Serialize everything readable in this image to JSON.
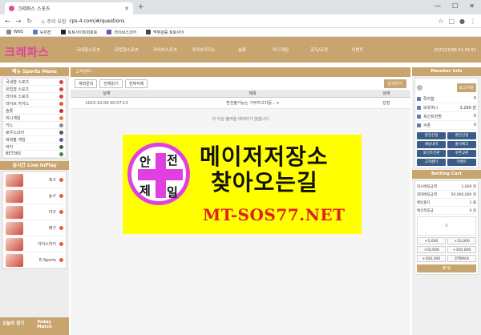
{
  "browser": {
    "tab_title": "크레파스 스포츠",
    "address_warning": "주의 요함",
    "url": "cps-4.com/#/questions",
    "bookmarks": [
      "WNS",
      "뉴미젼",
      "토토사이트회토토",
      "라이브스코어",
      "먹튀검증 토토사이"
    ]
  },
  "header": {
    "logo": "크레파스",
    "nav": [
      "국내형스포츠",
      "유럽형스포츠",
      "라이브스포츠",
      "라이브카지노",
      "슬롯",
      "미니게임",
      "공지/규정",
      "이벤트"
    ],
    "datetime": "2022/10/06 01:05:51"
  },
  "left": {
    "menu_title": "메뉴 Sports Menu",
    "sports": [
      {
        "label": "국내형 스포츠",
        "color": "#d24141"
      },
      {
        "label": "유럽형 스포츠",
        "color": "#d24141"
      },
      {
        "label": "라이브 스포츠",
        "color": "#d24141"
      },
      {
        "label": "라이브 카지노",
        "color": "#e06020"
      },
      {
        "label": "슬롯",
        "color": "#c03030"
      },
      {
        "label": "미니게임",
        "color": "#e08030"
      },
      {
        "label": "키노",
        "color": "#888888"
      },
      {
        "label": "로우스코어",
        "color": "#555555"
      },
      {
        "label": "파워볼 게임",
        "color": "#5a5ab0"
      },
      {
        "label": "바카",
        "color": "#555555"
      },
      {
        "label": "BET365",
        "color": "#3a8a3a"
      }
    ],
    "inplay_title": "실시간 Live InPlay",
    "inplay": [
      "축구",
      "농구",
      "야구",
      "배구",
      "아이스하키",
      "E-Sports"
    ],
    "today_title_1": "오늘의 경기",
    "today_title_2": "Today Match"
  },
  "main": {
    "title": "고객센터",
    "tabs": [
      "계좌문의",
      "전체읽기",
      "전체삭제"
    ],
    "inquiry_button": "문의하기",
    "columns": [
      "날짜",
      "제목",
      "상태"
    ],
    "rows": [
      {
        "date": "2022-10-06 00:57:13",
        "title": "환전불가능는 거부하고자동...",
        "status": "답장"
      }
    ],
    "notice": "더 이상 불러올 데이터가 없습니다"
  },
  "right": {
    "member_title": "Member Info",
    "logout": "로그아웃",
    "info_rows": [
      {
        "label": "쪽지함",
        "value": "0"
      },
      {
        "label": "보유머니",
        "value": "3,290 원"
      },
      {
        "label": "포인트전환",
        "value": "0"
      },
      {
        "label": "쿠폰",
        "value": "0"
      }
    ],
    "buttons": [
      "충전신청",
      "환전신청",
      "베팅내역",
      "출석체크",
      "포인트전환",
      "쿠폰교환",
      "고객센터",
      "이벤트"
    ],
    "cart_title": "Betting Cart",
    "cart_rows": [
      {
        "label": "최소배팅금액",
        "value": "1,000 원"
      },
      {
        "label": "최대배팅금액",
        "value": "50,000,000 원"
      },
      {
        "label": "배팅폴더",
        "value": "1 폴"
      },
      {
        "label": "예상적중금",
        "value": "0 원"
      }
    ],
    "amounts": [
      "+5,000",
      "+10,000",
      "+50,000",
      "+100,000",
      "+500,000",
      "잔액MAX"
    ],
    "bet_button": "배 팅"
  },
  "ad": {
    "circle_chars": [
      "안",
      "전",
      "제",
      "일"
    ],
    "line1": "메이저저장소",
    "line2": "찾아오는길",
    "url": "MT-SOS77.NET"
  }
}
